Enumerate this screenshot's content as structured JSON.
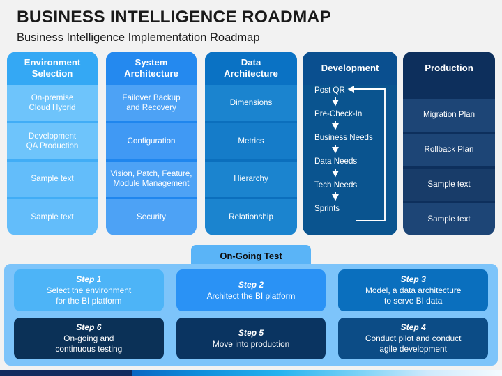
{
  "title": "BUSINESS INTELLIGENCE ROADMAP",
  "subtitle": "Business Intelligence Implementation Roadmap",
  "colors": {
    "slide_background": "#f2f2f2",
    "col1_header": "#34a8f4",
    "col1_cell_light": "#6ec4fb",
    "col1_cell_dark": "#63bdfa",
    "col2_header": "#2489ef",
    "col2_cell_light": "#4da2f5",
    "col2_cell_dark": "#4099f4",
    "col3_header": "#0a72c4",
    "col3_cell_light": "#1b84cf",
    "col3_cell_dark": "#157cc9",
    "col4_header": "#0a4f8f",
    "col4_body": "#0a548f",
    "col5_header": "#0d2f5c",
    "col5_cell_light": "#1d4576",
    "col5_cell_dark": "#183c69",
    "ongoing_tab": "#5ab4f7",
    "bottom_panel": "#7dc4fa",
    "step1": "#4db4f7",
    "step2": "#2a92f5",
    "step3": "#0a6fbe",
    "step4": "#0c4c86",
    "step5": "#0a3461",
    "step6": "#0b3157",
    "footer_dark": "#132a5e"
  },
  "columns": [
    {
      "id": "environment-selection",
      "header": "Environment\nSelection",
      "cells": [
        "On-premise\nCloud Hybrid",
        "Development\nQA Production",
        "Sample text",
        "Sample text"
      ]
    },
    {
      "id": "system-architecture",
      "header": "System\nArchitecture",
      "cells": [
        "Failover Backup\nand Recovery",
        "Configuration",
        "Vision, Patch, Feature,\nModule Management",
        "Security"
      ]
    },
    {
      "id": "data-architecture",
      "header": "Data\nArchitecture",
      "cells": [
        "Dimensions",
        "Metrics",
        "Hierarchy",
        "Relationship"
      ]
    },
    {
      "id": "development",
      "header": "Development",
      "flow_nodes": [
        "Post QR",
        "Pre-Check-In",
        "Business Needs",
        "Data Needs",
        "Tech Needs",
        "Sprints"
      ],
      "flow_loop": "Sprints loops back to Post QR"
    },
    {
      "id": "production",
      "header": "Production",
      "cells": [
        "Migration Plan",
        "Rollback Plan",
        "Sample text",
        "Sample text"
      ]
    }
  ],
  "ongoing_test_tab": "On-Going Test",
  "steps": [
    {
      "id": "step-1",
      "label": "Step 1",
      "desc": "Select the environment\nfor the BI platform"
    },
    {
      "id": "step-2",
      "label": "Step 2",
      "desc": "Architect the BI platform"
    },
    {
      "id": "step-3",
      "label": "Step 3",
      "desc": "Model, a data architecture\nto serve BI data"
    },
    {
      "id": "step-6",
      "label": "Step 6",
      "desc": "On-going and\ncontinuous testing"
    },
    {
      "id": "step-5",
      "label": "Step 5",
      "desc": "Move into production"
    },
    {
      "id": "step-4",
      "label": "Step 4",
      "desc": "Conduct pilot and conduct\nagile development"
    }
  ]
}
